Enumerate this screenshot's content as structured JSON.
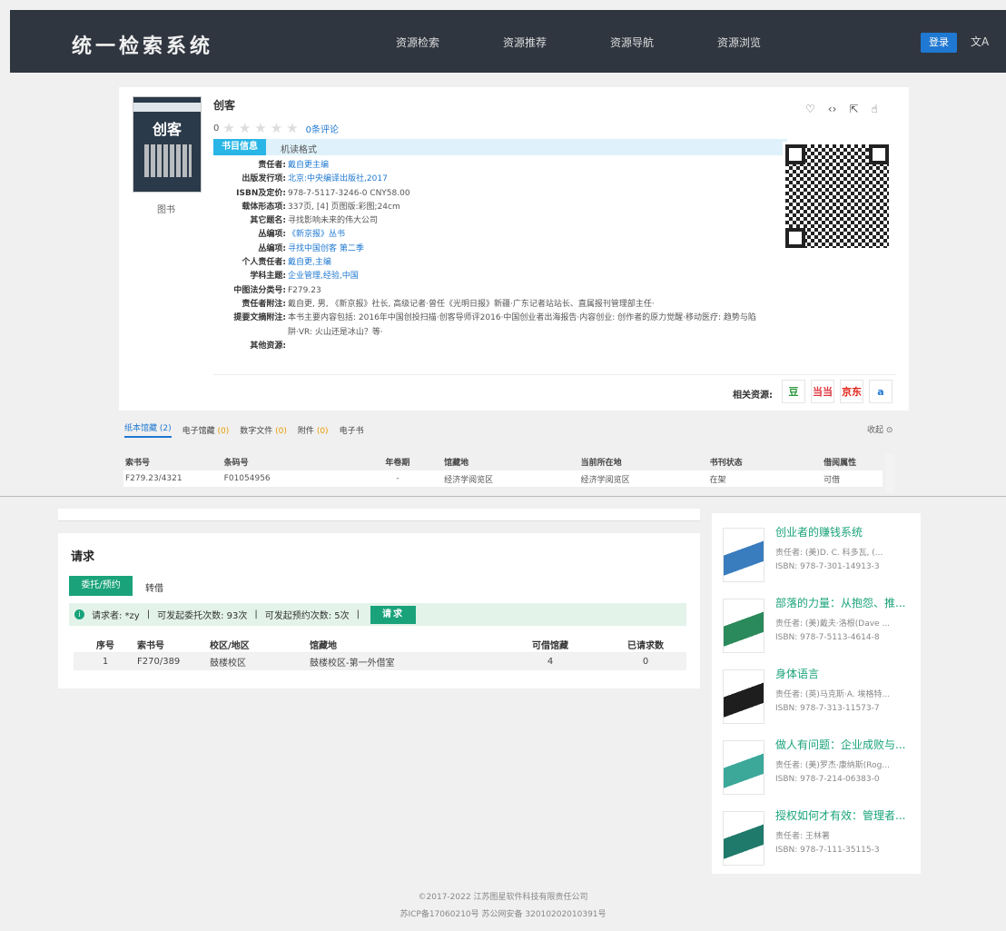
{
  "nav": {
    "brand": "统一检索系统",
    "links": [
      "资源检索",
      "资源推荐",
      "资源导航",
      "资源浏览"
    ],
    "login": "登录",
    "lang_icon": "translate-icon"
  },
  "book": {
    "cover_title": "创客",
    "doc_type": "图书",
    "title": "创客",
    "rating_value": "0",
    "reviews": "0条评论",
    "tab_active": "书目信息",
    "tab_other": "机读格式",
    "fields": [
      {
        "k": "责任者:",
        "v": "戴自更主编"
      },
      {
        "k": "出版发行项:",
        "v": "北京:中央编译出版社,2017"
      },
      {
        "k": "ISBN及定价:",
        "v": "978-7-5117-3246-0 CNY58.00"
      },
      {
        "k": "载体形态项:",
        "v": "337页, [4] 页图版:彩图;24cm"
      },
      {
        "k": "其它题名:",
        "v": "寻找影响未来的伟大公司"
      },
      {
        "k": "丛编项:",
        "v": "《新京报》丛书"
      },
      {
        "k": "丛编项:",
        "v": "寻找中国创客 第二季"
      },
      {
        "k": "个人责任者:",
        "v": "戴自更,主编"
      },
      {
        "k": "学科主题:",
        "v": "企业管理,经验,中国"
      },
      {
        "k": "中图法分类号:",
        "v": "F279.23"
      },
      {
        "k": "责任者附注:",
        "v": "戴自更, 男, 《新京报》社长, 高级记者·曾任《光明日报》新疆·广东记者站站长、直属报刊管理部主任·"
      },
      {
        "k": "提要文摘附注:",
        "v": "本书主要内容包括: 2016年中国创投扫描·创客导师评2016·中国创业者出海报告·内容创业: 创作者的原力觉醒·移动医疗: 趋势与陷阱·VR: 火山还是冰山？等·"
      },
      {
        "k": "其他资源:",
        "v": ""
      }
    ],
    "actions": [
      "heart-icon",
      "code-icon",
      "share-icon",
      "like-icon"
    ],
    "related_label": "相关资源:",
    "related": [
      {
        "name": "豆",
        "color": "#2b9a3d"
      },
      {
        "name": "当当",
        "color": "#e0353f"
      },
      {
        "name": "京东",
        "color": "#e1251b"
      },
      {
        "name": "a",
        "color": "#1f78d1"
      }
    ]
  },
  "holdings": {
    "tabs": [
      {
        "label": "纸本馆藏",
        "count": "(2)"
      },
      {
        "label": "电子馆藏",
        "count": "(0)"
      },
      {
        "label": "数字文件",
        "count": "(0)"
      },
      {
        "label": "附件",
        "count": "(0)"
      },
      {
        "label": "电子书",
        "count": ""
      }
    ],
    "collapse": "收起",
    "headers": [
      "索书号",
      "条码号",
      "年卷期",
      "馆藏地",
      "当前所在地",
      "书刊状态",
      "借阅属性"
    ],
    "rows": [
      [
        "F279.23/4321",
        "F01054956",
        "-",
        "经济学阅览区",
        "经济学阅览区",
        "在架",
        "可借"
      ]
    ]
  },
  "request": {
    "title": "请求",
    "tab_active": "委托/预约",
    "tab_other": "转借",
    "requester": "请求者: *zy",
    "sep": "|",
    "entrust": "可发起委托次数: 93次",
    "reserve": "可发起预约次数: 5次",
    "button": "请求",
    "headers": [
      "序号",
      "索书号",
      "校区/地区",
      "馆藏地",
      "可借馆藏",
      "已请求数"
    ],
    "rows": [
      [
        "1",
        "F270/389",
        "鼓楼校区",
        "鼓楼校区-第一外借室",
        "4",
        "0"
      ]
    ]
  },
  "recommendations": [
    {
      "title": "创业者的赚钱系统",
      "author": "责任者: (美)D. C. 科多瓦, (...",
      "isbn": "ISBN: 978-7-301-14913-3",
      "color": "#3a7dbf"
    },
    {
      "title": "部落的力量：从抱怨、推...",
      "author": "责任者: (美)戴夫·洛根(Dave ...",
      "isbn": "ISBN: 978-7-5113-4614-8",
      "color": "#2b8a5b"
    },
    {
      "title": "身体语言",
      "author": "责任者: (英)马克斯·A. 埃格特...",
      "isbn": "ISBN: 978-7-313-11573-7",
      "color": "#1e1e1e"
    },
    {
      "title": "做人有问题：企业成败与...",
      "author": "责任者: (美)罗杰·康纳斯(Rog...",
      "isbn": "ISBN: 978-7-214-06383-0",
      "color": "#3ba89a"
    },
    {
      "title": "授权如何才有效：管理者...",
      "author": "责任者: 王林著",
      "isbn": "ISBN: 978-7-111-35115-3",
      "color": "#1f7a6b"
    }
  ],
  "footer": {
    "copyright": "©2017-2022 江苏图星软件科技有限责任公司",
    "icp": "苏ICP备17060210号   苏公网安备 32010202010391号"
  }
}
